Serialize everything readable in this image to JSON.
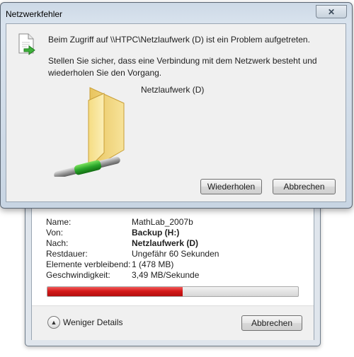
{
  "error_dialog": {
    "title": "Netzwerkfehler",
    "close_label": "✕",
    "message_main": "Beim Zugriff auf \\\\HTPC\\Netzlaufwerk (D) ist ein Problem aufgetreten.",
    "message_hint": "Stellen Sie sicher, dass eine Verbindung mit dem Netzwerk besteht und wiederholen Sie den Vorgang.",
    "item_name": "Netzlaufwerk (D)",
    "retry_label": "Wiederholen",
    "cancel_label": "Abbrechen",
    "icons": [
      "document-error-icon",
      "network-folder-icon"
    ]
  },
  "copy_dialog": {
    "rows": [
      {
        "label": "Name:",
        "value": "MathLab_2007b"
      },
      {
        "label": "Von:",
        "value": "Backup (H:)"
      },
      {
        "label": "Nach:",
        "value": "Netzlaufwerk (D)"
      },
      {
        "label": "Restdauer:",
        "value": "Ungefähr 60 Sekunden"
      },
      {
        "label": "Elemente verbleibend:",
        "value": "1 (478 MB)"
      },
      {
        "label": "Geschwindigkeit:",
        "value": "3,49 MB/Sekunde"
      }
    ],
    "progress_fraction": 0.54,
    "progress_color": "#d41919",
    "less_details_label": "Weniger Details",
    "cancel_label": "Abbrechen"
  }
}
